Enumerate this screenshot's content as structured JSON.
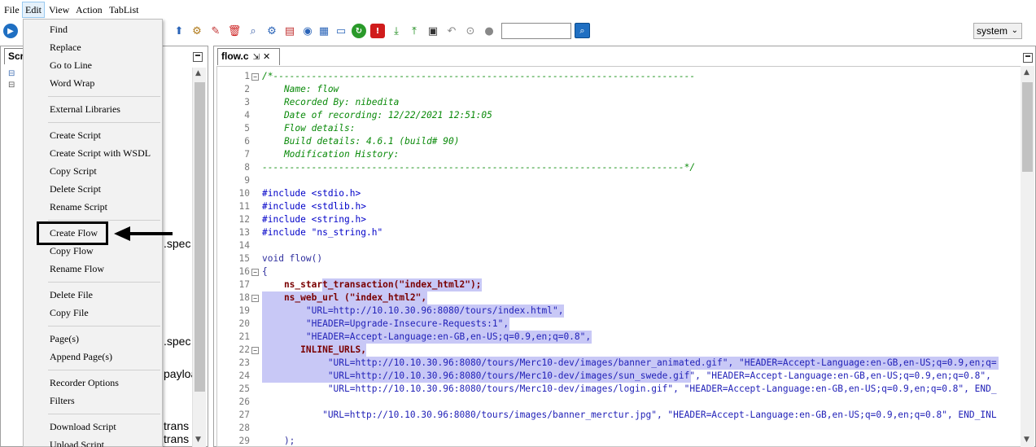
{
  "menubar": [
    "File",
    "Edit",
    "View",
    "Action",
    "TabList"
  ],
  "search": {
    "value": "",
    "placeholder": ""
  },
  "system_select": {
    "value": "system"
  },
  "left_panel": {
    "tab_label": "Scr",
    "fragments": [
      ".spec",
      "",
      ".spec",
      "payloa",
      "trans",
      "trans"
    ]
  },
  "edit_menu": {
    "items": [
      "Find",
      "Replace",
      "Go to Line",
      "Word Wrap",
      "External Libraries",
      "Create Script",
      "Create Script with WSDL",
      "Copy Script",
      "Delete Script",
      "Rename Script",
      "Create Flow",
      "Copy Flow",
      "Rename Flow",
      "Delete File",
      "Copy File",
      "Page(s)",
      "Append Page(s)",
      "Recorder Options",
      "Filters",
      "Download Script",
      "Upload Script"
    ],
    "highlighted": "Create Flow"
  },
  "editor": {
    "tab_label": "flow.c",
    "lines": [
      {
        "n": "1",
        "fold": "−",
        "t": "/*-----------------------------------------------------------------------------"
      },
      {
        "n": "2",
        "t": "    Name: flow"
      },
      {
        "n": "3",
        "t": "    Recorded By: nibedita"
      },
      {
        "n": "4",
        "t": "    Date of recording: 12/22/2021 12:51:05"
      },
      {
        "n": "5",
        "t": "    Flow details:"
      },
      {
        "n": "6",
        "t": "    Build details: 4.6.1 (build# 90)"
      },
      {
        "n": "7",
        "t": "    Modification History:"
      },
      {
        "n": "8",
        "t": "-----------------------------------------------------------------------------*/"
      },
      {
        "n": "9",
        "t": ""
      },
      {
        "n": "10",
        "t": "#include <stdio.h>"
      },
      {
        "n": "11",
        "t": "#include <stdlib.h>"
      },
      {
        "n": "12",
        "t": "#include <string.h>"
      },
      {
        "n": "13",
        "t": "#include \"ns_string.h\""
      },
      {
        "n": "14",
        "t": ""
      },
      {
        "n": "15",
        "t": "void flow()"
      },
      {
        "n": "16",
        "fold": "−",
        "t": "{"
      },
      {
        "n": "17",
        "t": "    ns_start_transaction(\"index_html2\");"
      },
      {
        "n": "18",
        "fold": "−",
        "t": "    ns_web_url (\"index_html2\","
      },
      {
        "n": "19",
        "t": "        \"URL=http://10.10.30.96:8080/tours/index.html\","
      },
      {
        "n": "20",
        "t": "        \"HEADER=Upgrade-Insecure-Requests:1\","
      },
      {
        "n": "21",
        "t": "        \"HEADER=Accept-Language:en-GB,en-US;q=0.9,en;q=0.8\","
      },
      {
        "n": "22",
        "fold": "−",
        "t": "       INLINE_URLS,"
      },
      {
        "n": "23",
        "t": "            \"URL=http://10.10.30.96:8080/tours/Merc10-dev/images/banner_animated.gif\", \"HEADER=Accept-Language:en-GB,en-US;q=0.9,en;q="
      },
      {
        "n": "24",
        "t": "            \"URL=http://10.10.30.96:8080/tours/Merc10-dev/images/sun_swede.gif\", \"HEADER=Accept-Language:en-GB,en-US;q=0.9,en;q=0.8\","
      },
      {
        "n": "25",
        "t": "            \"URL=http://10.10.30.96:8080/tours/Merc10-dev/images/login.gif\", \"HEADER=Accept-Language:en-GB,en-US;q=0.9,en;q=0.8\", END_"
      },
      {
        "n": "26",
        "t": ""
      },
      {
        "n": "27",
        "t": "           \"URL=http://10.10.30.96:8080/tours/images/banner_merctur.jpg\", \"HEADER=Accept-Language:en-GB,en-US;q=0.9,en;q=0.8\", END_INL"
      },
      {
        "n": "28",
        "t": ""
      },
      {
        "n": "29",
        "t": "    );"
      }
    ]
  },
  "colors": {
    "selection": "#c8c8f6",
    "comment": "#0a8a0a",
    "menu_bg": "#f2f2f2"
  }
}
